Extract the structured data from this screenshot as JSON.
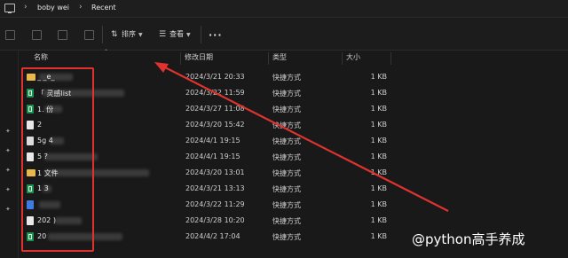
{
  "breadcrumb": {
    "items": [
      "boby wei",
      "Recent"
    ]
  },
  "toolbar": {
    "sort_label": "排序",
    "view_label": "查看",
    "more_label": "···"
  },
  "columns": {
    "name": "名称",
    "date": "修改日期",
    "type": "类型",
    "size": "大小"
  },
  "rows": [
    {
      "name": "_ _e_",
      "date": "2024/3/21 20:33",
      "type": "快捷方式",
      "size": "1 KB"
    },
    {
      "name": "「              灵感list",
      "date": "2024/3/22 11:59",
      "type": "快捷方式",
      "size": "1 KB"
    },
    {
      "name": "1.    份",
      "date": "2024/3/27 11:08",
      "type": "快捷方式",
      "size": "1 KB"
    },
    {
      "name": "2",
      "date": "2024/3/20 15:42",
      "type": "快捷方式",
      "size": "1 KB"
    },
    {
      "name": "5g    4",
      "date": "2024/4/1 19:15",
      "type": "快捷方式",
      "size": "1 KB"
    },
    {
      "name": "5              ?",
      "date": "2024/4/1 19:15",
      "type": "快捷方式",
      "size": "1 KB"
    },
    {
      "name": "1                        文件",
      "date": "2024/3/20 13:01",
      "type": "快捷方式",
      "size": "1 KB"
    },
    {
      "name": "1  3",
      "date": "2024/3/21 13:13",
      "type": "快捷方式",
      "size": "1 KB"
    },
    {
      "name": "",
      "date": "2024/3/22 11:29",
      "type": "快捷方式",
      "size": "1 KB"
    },
    {
      "name": "202         )",
      "date": "2024/3/28 10:20",
      "type": "快捷方式",
      "size": "1 KB"
    },
    {
      "name": "20",
      "date": "2024/4/2 17:04",
      "type": "快捷方式",
      "size": "1 KB"
    }
  ],
  "watermark": "@python高手养成",
  "colors": {
    "annotation": "#e0322f",
    "background": "#191919"
  }
}
